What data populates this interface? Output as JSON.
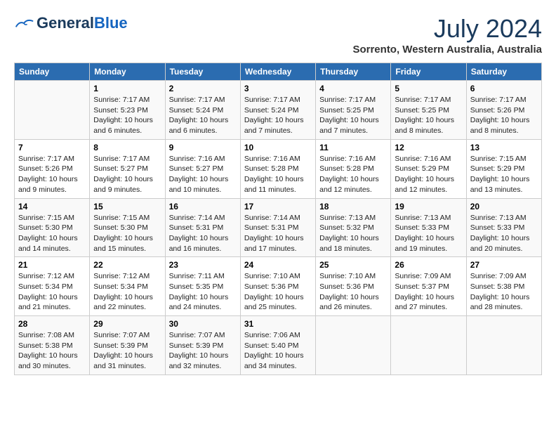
{
  "header": {
    "logo_general": "General",
    "logo_blue": "Blue",
    "month_year": "July 2024",
    "location": "Sorrento, Western Australia, Australia"
  },
  "weekdays": [
    "Sunday",
    "Monday",
    "Tuesday",
    "Wednesday",
    "Thursday",
    "Friday",
    "Saturday"
  ],
  "weeks": [
    [
      {
        "day": "",
        "content": ""
      },
      {
        "day": "1",
        "content": "Sunrise: 7:17 AM\nSunset: 5:23 PM\nDaylight: 10 hours\nand 6 minutes."
      },
      {
        "day": "2",
        "content": "Sunrise: 7:17 AM\nSunset: 5:24 PM\nDaylight: 10 hours\nand 6 minutes."
      },
      {
        "day": "3",
        "content": "Sunrise: 7:17 AM\nSunset: 5:24 PM\nDaylight: 10 hours\nand 7 minutes."
      },
      {
        "day": "4",
        "content": "Sunrise: 7:17 AM\nSunset: 5:25 PM\nDaylight: 10 hours\nand 7 minutes."
      },
      {
        "day": "5",
        "content": "Sunrise: 7:17 AM\nSunset: 5:25 PM\nDaylight: 10 hours\nand 8 minutes."
      },
      {
        "day": "6",
        "content": "Sunrise: 7:17 AM\nSunset: 5:26 PM\nDaylight: 10 hours\nand 8 minutes."
      }
    ],
    [
      {
        "day": "7",
        "content": "Sunrise: 7:17 AM\nSunset: 5:26 PM\nDaylight: 10 hours\nand 9 minutes."
      },
      {
        "day": "8",
        "content": "Sunrise: 7:17 AM\nSunset: 5:27 PM\nDaylight: 10 hours\nand 9 minutes."
      },
      {
        "day": "9",
        "content": "Sunrise: 7:16 AM\nSunset: 5:27 PM\nDaylight: 10 hours\nand 10 minutes."
      },
      {
        "day": "10",
        "content": "Sunrise: 7:16 AM\nSunset: 5:28 PM\nDaylight: 10 hours\nand 11 minutes."
      },
      {
        "day": "11",
        "content": "Sunrise: 7:16 AM\nSunset: 5:28 PM\nDaylight: 10 hours\nand 12 minutes."
      },
      {
        "day": "12",
        "content": "Sunrise: 7:16 AM\nSunset: 5:29 PM\nDaylight: 10 hours\nand 12 minutes."
      },
      {
        "day": "13",
        "content": "Sunrise: 7:15 AM\nSunset: 5:29 PM\nDaylight: 10 hours\nand 13 minutes."
      }
    ],
    [
      {
        "day": "14",
        "content": "Sunrise: 7:15 AM\nSunset: 5:30 PM\nDaylight: 10 hours\nand 14 minutes."
      },
      {
        "day": "15",
        "content": "Sunrise: 7:15 AM\nSunset: 5:30 PM\nDaylight: 10 hours\nand 15 minutes."
      },
      {
        "day": "16",
        "content": "Sunrise: 7:14 AM\nSunset: 5:31 PM\nDaylight: 10 hours\nand 16 minutes."
      },
      {
        "day": "17",
        "content": "Sunrise: 7:14 AM\nSunset: 5:31 PM\nDaylight: 10 hours\nand 17 minutes."
      },
      {
        "day": "18",
        "content": "Sunrise: 7:13 AM\nSunset: 5:32 PM\nDaylight: 10 hours\nand 18 minutes."
      },
      {
        "day": "19",
        "content": "Sunrise: 7:13 AM\nSunset: 5:33 PM\nDaylight: 10 hours\nand 19 minutes."
      },
      {
        "day": "20",
        "content": "Sunrise: 7:13 AM\nSunset: 5:33 PM\nDaylight: 10 hours\nand 20 minutes."
      }
    ],
    [
      {
        "day": "21",
        "content": "Sunrise: 7:12 AM\nSunset: 5:34 PM\nDaylight: 10 hours\nand 21 minutes."
      },
      {
        "day": "22",
        "content": "Sunrise: 7:12 AM\nSunset: 5:34 PM\nDaylight: 10 hours\nand 22 minutes."
      },
      {
        "day": "23",
        "content": "Sunrise: 7:11 AM\nSunset: 5:35 PM\nDaylight: 10 hours\nand 24 minutes."
      },
      {
        "day": "24",
        "content": "Sunrise: 7:10 AM\nSunset: 5:36 PM\nDaylight: 10 hours\nand 25 minutes."
      },
      {
        "day": "25",
        "content": "Sunrise: 7:10 AM\nSunset: 5:36 PM\nDaylight: 10 hours\nand 26 minutes."
      },
      {
        "day": "26",
        "content": "Sunrise: 7:09 AM\nSunset: 5:37 PM\nDaylight: 10 hours\nand 27 minutes."
      },
      {
        "day": "27",
        "content": "Sunrise: 7:09 AM\nSunset: 5:38 PM\nDaylight: 10 hours\nand 28 minutes."
      }
    ],
    [
      {
        "day": "28",
        "content": "Sunrise: 7:08 AM\nSunset: 5:38 PM\nDaylight: 10 hours\nand 30 minutes."
      },
      {
        "day": "29",
        "content": "Sunrise: 7:07 AM\nSunset: 5:39 PM\nDaylight: 10 hours\nand 31 minutes."
      },
      {
        "day": "30",
        "content": "Sunrise: 7:07 AM\nSunset: 5:39 PM\nDaylight: 10 hours\nand 32 minutes."
      },
      {
        "day": "31",
        "content": "Sunrise: 7:06 AM\nSunset: 5:40 PM\nDaylight: 10 hours\nand 34 minutes."
      },
      {
        "day": "",
        "content": ""
      },
      {
        "day": "",
        "content": ""
      },
      {
        "day": "",
        "content": ""
      }
    ]
  ]
}
